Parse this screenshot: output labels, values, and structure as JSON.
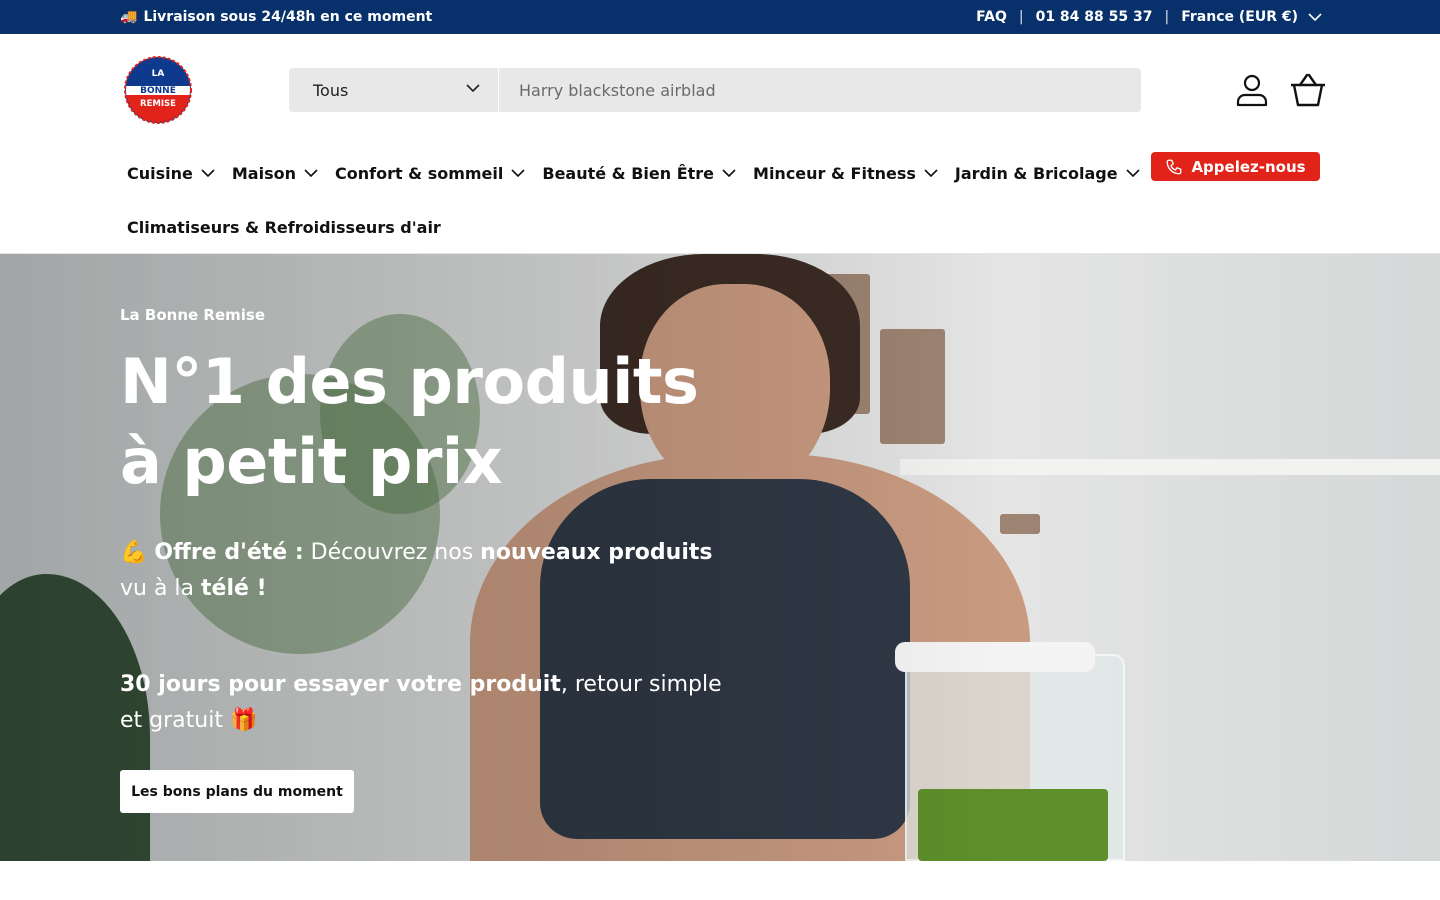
{
  "topbar": {
    "truck_icon": "🚚",
    "announcement": "Livraison sous 24/48h en ce moment",
    "faq": "FAQ",
    "separator": "|",
    "phone": "01 84 88 55 37",
    "country": "France (EUR €)"
  },
  "logo": {
    "line1": "LA",
    "line2": "BONNE",
    "line3": "REMISE",
    "colors": {
      "blue": "#0d3a8c",
      "red": "#e2231a"
    }
  },
  "search": {
    "category": "Tous",
    "placeholder": "Harry blackstone airblad"
  },
  "nav": {
    "items": [
      {
        "label": "Cuisine"
      },
      {
        "label": "Maison"
      },
      {
        "label": "Confort & sommeil"
      },
      {
        "label": "Beauté & Bien Être"
      },
      {
        "label": "Minceur & Fitness"
      },
      {
        "label": "Jardin & Bricolage"
      }
    ],
    "second_row": "Climatiseurs & Refroidisseurs d'air",
    "call_button": "Appelez-nous"
  },
  "hero": {
    "eyebrow": "La Bonne Remise",
    "title": "N°1 des produits à petit prix",
    "offer": {
      "emoji": "💪",
      "bold1": "Offre d'été :",
      "text1": " Découvrez nos ",
      "bold2": "nouveaux produits",
      "text2": " vu à la ",
      "bold3": "télé !"
    },
    "trial": {
      "bold": "30 jours pour essayer votre produit",
      "text": ", retour simple et gratuit ",
      "emoji": "🎁"
    },
    "button": "Les bons plans du moment"
  },
  "colors": {
    "topbar_bg": "#08316b",
    "accent_red": "#e2231a",
    "search_bg": "#e8e8e8"
  }
}
